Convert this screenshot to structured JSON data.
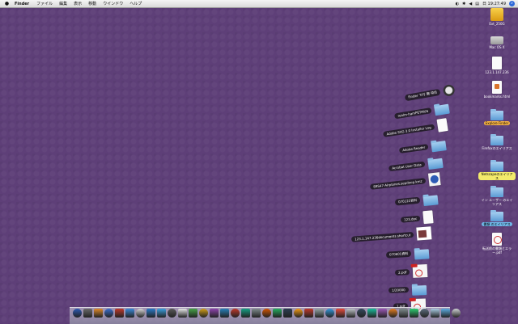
{
  "menubar": {
    "apple": "",
    "app_name": "Finder",
    "menus": [
      "ファイル",
      "編集",
      "表示",
      "移動",
      "ウインドウ",
      "ヘルプ"
    ],
    "clock": "日 19:27:49"
  },
  "desktop_icons": [
    {
      "label": "Ext_250G",
      "icon": "external-drive-icon",
      "kind": "ext",
      "label_style": ""
    },
    {
      "label": "Mac OS X",
      "icon": "hard-drive-icon",
      "kind": "hdd",
      "label_style": ""
    },
    {
      "label": "123.1.147.236",
      "icon": "location-icon",
      "kind": "doc at",
      "label_style": ""
    },
    {
      "label": "bookmarks.html",
      "icon": "html-document-icon",
      "kind": "doc html",
      "label_style": ""
    },
    {
      "label": "Explore Finder",
      "icon": "folder-icon",
      "kind": "folder",
      "label_style": "orange"
    },
    {
      "label": "Firefoxのエイリアス",
      "icon": "folder-icon",
      "kind": "folder",
      "label_style": ""
    },
    {
      "label": "Netscapeのエイリアス",
      "icon": "folder-icon",
      "kind": "folder",
      "label_style": "yellow"
    },
    {
      "label": "イン ユーザー のエイリアス",
      "icon": "folder-icon",
      "kind": "folder",
      "label_style": ""
    },
    {
      "label": "書類 のエイリアス",
      "icon": "folder-icon",
      "kind": "folder",
      "label_style": "blue"
    },
    {
      "label": "転送前の書類とエラー.pdf",
      "icon": "pdf-document-icon",
      "kind": "doc pdf",
      "label_style": ""
    }
  ],
  "stack_fan": [
    {
      "label": "Finder で行 開 項目",
      "icon": "open-in-finder-icon",
      "kind": "gear"
    },
    {
      "label": "realm-hamPETMUS",
      "icon": "folder-icon",
      "kind": "folder"
    },
    {
      "label": "Adobe SVG 3.0 Installer Log",
      "icon": "document-icon",
      "kind": "doc"
    },
    {
      "label": "Adobe Reader",
      "icon": "folder-icon",
      "kind": "folder"
    },
    {
      "label": "Acrobat User Data",
      "icon": "folder-icon",
      "kind": "folder"
    },
    {
      "label": "89S47-Airplanes.sepdoop.kmz",
      "icon": "kmz-document-icon",
      "kind": "globe"
    },
    {
      "label": "070122資料",
      "icon": "folder-icon",
      "kind": "folder"
    },
    {
      "label": "123.doc",
      "icon": "document-icon",
      "kind": "doc"
    },
    {
      "label": "123.1.147.236documents shortcut",
      "icon": "image-document-icon",
      "kind": "img"
    },
    {
      "label": "070601資料",
      "icon": "folder-icon",
      "kind": "folder"
    },
    {
      "label": "2.pdf",
      "icon": "pdf-document-icon",
      "kind": "pdfdoc"
    },
    {
      "label": "1/20000",
      "icon": "folder-icon",
      "kind": "folder"
    },
    {
      "label": "1.pdf",
      "icon": "pdf-document-icon",
      "kind": "pdfdoc"
    }
  ],
  "dock_colors": [
    "#2d5bb5",
    "#6a6a6a",
    "#e08a2a",
    "#3a6fd0",
    "#c0392b",
    "#3b8ad9",
    "#d9d9d9",
    "#2a7ac7",
    "#3aa0e0",
    "#5a5a5a",
    "#e9e9e9",
    "#47a447",
    "#d4a017",
    "#8e44ad",
    "#2980b9",
    "#c0392b",
    "#16a085",
    "#7f8c8d",
    "#d35400",
    "#27ae60",
    "#2c3e50",
    "#f39c12",
    "#c0392b",
    "#95a5a6",
    "#3498db",
    "#e74c3c",
    "#bdc3c7",
    "#34495e",
    "#1abc9c",
    "#9b59b6",
    "#e67e22",
    "#7f8c8d",
    "#2ecc71",
    "#5d6d7e",
    "#a9cce3",
    "#5dade2",
    "#d0d3d4"
  ]
}
